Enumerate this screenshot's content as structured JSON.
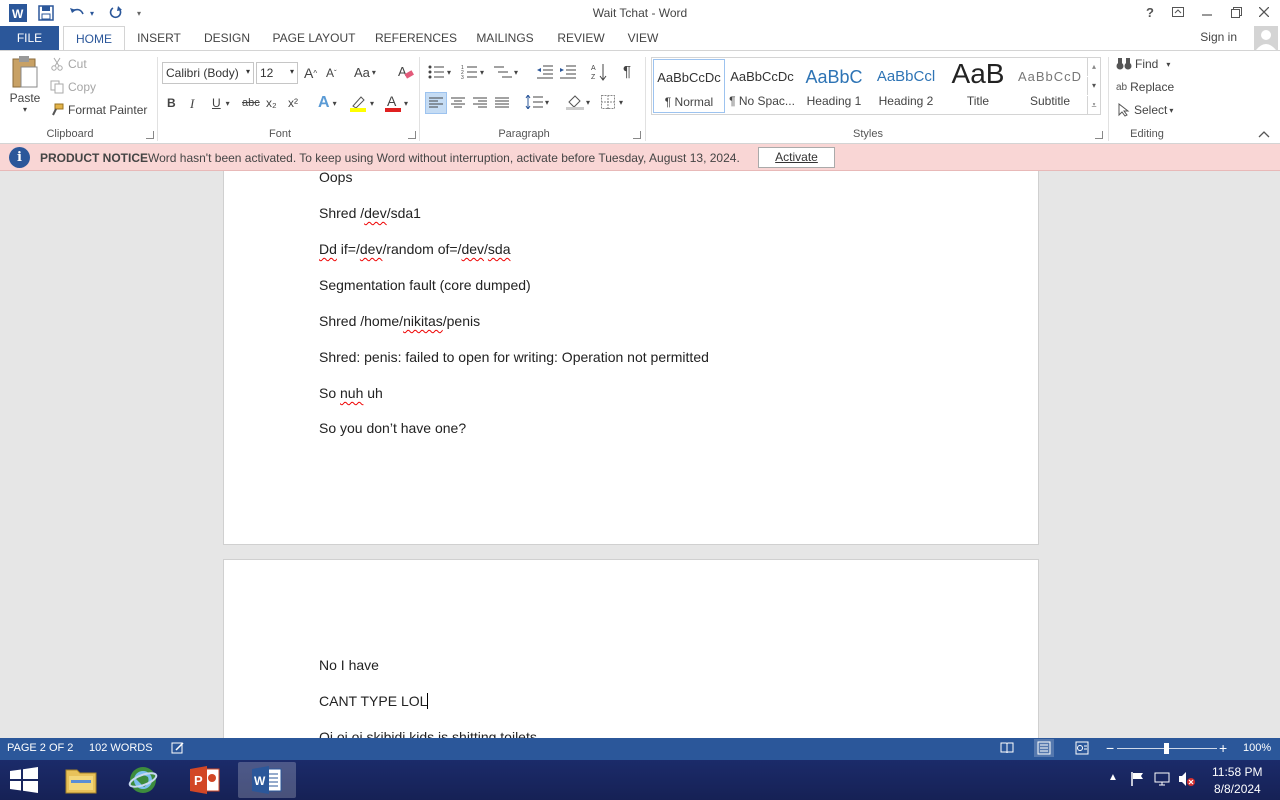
{
  "window": {
    "title": "Wait Tchat - Word",
    "help": "?",
    "controls": [
      "restore-ribbon",
      "minimize",
      "restore",
      "close"
    ]
  },
  "tabs": [
    "FILE",
    "HOME",
    "INSERT",
    "DESIGN",
    "PAGE LAYOUT",
    "REFERENCES",
    "MAILINGS",
    "REVIEW",
    "VIEW"
  ],
  "active_tab": "HOME",
  "account": {
    "signin": "Sign in"
  },
  "ribbon": {
    "clipboard": {
      "paste": "Paste",
      "cut": "Cut",
      "copy": "Copy",
      "format_painter": "Format Painter",
      "label": "Clipboard"
    },
    "font": {
      "family": "Calibri (Body)",
      "size": "12",
      "change_case": "Aa",
      "bold": "B",
      "italic": "I",
      "underline": "U",
      "strike": "abc",
      "subscript": "x₂",
      "superscript": "x²",
      "label": "Font"
    },
    "paragraph": {
      "pilcrow": "¶",
      "label": "Paragraph"
    },
    "styles": {
      "label": "Styles",
      "items": [
        {
          "preview": "AaBbCcDc",
          "name": "¶ Normal"
        },
        {
          "preview": "AaBbCcDc",
          "name": "¶ No Spac..."
        },
        {
          "preview": "AaBbC",
          "name": "Heading 1"
        },
        {
          "preview": "AaBbCcl",
          "name": "Heading 2"
        },
        {
          "preview": "AaB",
          "name": "Title"
        },
        {
          "preview": "AaBbCcD",
          "name": "Subtitle"
        }
      ]
    },
    "editing": {
      "find": "Find",
      "replace": "Replace",
      "select": "Select",
      "label": "Editing"
    }
  },
  "notice": {
    "heading": "PRODUCT NOTICE",
    "message": "Word hasn't been activated. To keep using Word without interruption, activate before Tuesday, August 13, 2024.",
    "action": "Activate"
  },
  "document": {
    "page1": [
      "Oops",
      "Shred /dev/sda1",
      "Dd if=/dev/random of=/dev/sda",
      "Segmentation fault (core dumped)",
      "Shred /home/nikitas/penis",
      "Shred: penis: failed to open for writing: Operation not permitted",
      "So nuh uh",
      "So you don’t have one?"
    ],
    "page2": [
      "No I have",
      "CANT TYPE LOL",
      "Oi oi oi skibidi kids is shitting toilets"
    ]
  },
  "status": {
    "page": "PAGE 2 OF 2",
    "words": "102 WORDS",
    "zoom": "100%",
    "zoom_level": 1.0
  },
  "taskbar": {
    "apps": [
      "start",
      "file-explorer",
      "browser",
      "powerpoint",
      "word"
    ],
    "active_app": "word",
    "time": "11:58 PM",
    "date": "8/8/2024"
  },
  "colors": {
    "accent": "#2b579a",
    "notice_bg": "#f9d6d5",
    "taskbar": "#1b2b6a"
  }
}
